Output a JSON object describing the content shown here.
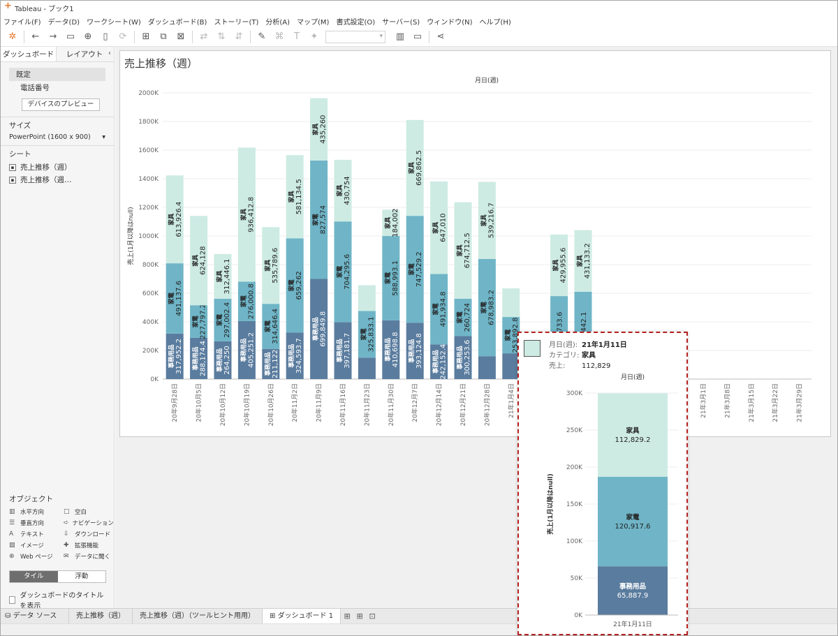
{
  "window": {
    "title": "Tableau - ブック1"
  },
  "menu": [
    "ファイル(F)",
    "データ(D)",
    "ワークシート(W)",
    "ダッシュボード(B)",
    "ストーリー(T)",
    "分析(A)",
    "マップ(M)",
    "書式設定(O)",
    "サーバー(S)",
    "ウィンドウ(N)",
    "ヘルプ(H)"
  ],
  "left_panel": {
    "tab_dashboard": "ダッシュボード",
    "tab_layout": "レイアウト",
    "preset_label": "既定",
    "phone_label": "電話番号",
    "device_preview_button": "デバイスのプレビュー",
    "size_heading": "サイズ",
    "size_value": "PowerPoint (1600 x 900)",
    "sheets_heading": "シート",
    "sheets": [
      "売上推移（週）",
      "売上推移（週…"
    ],
    "objects_heading": "オブジェクト",
    "objects": [
      {
        "label": "水平方向",
        "icon": "horizontal-icon"
      },
      {
        "label": "空白",
        "icon": "blank-icon"
      },
      {
        "label": "垂直方向",
        "icon": "vertical-icon"
      },
      {
        "label": "ナビゲーション",
        "icon": "navigation-icon"
      },
      {
        "label": "テキスト",
        "icon": "text-icon"
      },
      {
        "label": "ダウンロード",
        "icon": "download-icon"
      },
      {
        "label": "イメージ",
        "icon": "image-icon"
      },
      {
        "label": "拡張機能",
        "icon": "extension-icon"
      },
      {
        "label": "Web ページ",
        "icon": "web-icon"
      },
      {
        "label": "データに聞く",
        "icon": "ask-data-icon"
      }
    ],
    "tile_button": "タイル",
    "float_button": "浮動",
    "show_title_label": "ダッシュボードのタイトルを表示"
  },
  "bottom_tabs": {
    "data_source": "データ ソース",
    "tabs": [
      "売上推移（週）",
      "売上推移（週）（ツールヒント用用）",
      "ダッシュボード 1"
    ],
    "active_index": 2
  },
  "dashboard": {
    "title": "売上推移（週）"
  },
  "colors": {
    "furniture": "#cdebe3",
    "appliance": "#6fb5c7",
    "office": "#5a7c9e",
    "tooltip_border": "#b42121",
    "accent_orange": "#e8762b"
  },
  "chart_data": [
    {
      "type": "bar",
      "stacked": true,
      "column_header": "月日(週)",
      "ylabel": "売上(1月以降はnull)",
      "ylim": [
        0,
        2000000
      ],
      "yticks": [
        "0K",
        "200K",
        "400K",
        "600K",
        "800K",
        "1000K",
        "1200K",
        "1400K",
        "1600K",
        "1800K",
        "2000K"
      ],
      "categories": [
        "20年9月28日",
        "20年10月5日",
        "20年10月12日",
        "20年10月19日",
        "20年10月26日",
        "20年11月2日",
        "20年11月9日",
        "20年11月16日",
        "20年11月23日",
        "20年11月30日",
        "20年12月7日",
        "20年12月14日",
        "20年12月21日",
        "20年12月28日",
        "21年1月4日",
        "21年1月11日",
        "21年1月18日",
        "21年1月25日",
        "21年2月1日",
        "21年2月8日",
        "21年2月15日",
        "21年2月22日",
        "21年3月1日",
        "21年3月8日",
        "21年3月15日",
        "21年3月22日",
        "21年3月29日"
      ],
      "series": [
        {
          "name": "事務用品",
          "values": [
            317952.2,
            288174.4,
            264250,
            405251.2,
            211122,
            324593.7,
            699849.8,
            397181.7,
            150000,
            410698.8,
            393124.8,
            242152.4,
            300253.6,
            160000,
            180000,
            65887.9,
            160000,
            150000,
            null,
            null,
            null,
            null,
            null,
            null,
            null,
            null,
            null
          ],
          "labels": [
            "317,952.2",
            "288,174.4",
            "264,250",
            "405,251.2",
            "211,122",
            "324,593.7",
            "699,849.8",
            "397,181.7",
            "",
            "410,698.8",
            "393,124.8",
            "242,152.4",
            "300,253.6",
            "",
            "",
            "",
            "",
            "",
            "",
            "",
            "",
            "",
            "",
            "",
            "",
            "",
            ""
          ]
        },
        {
          "name": "家電",
          "values": [
            491137.6,
            227797.2,
            297002.4,
            276000.8,
            314646.4,
            659262,
            827574,
            704295.6,
            325833.1,
            588993.1,
            747529.2,
            491934.8,
            260724,
            678983.2,
            253892.8,
            120917.6,
            420000,
            460000,
            null,
            null,
            null,
            null,
            null,
            null,
            null,
            null,
            null
          ],
          "labels": [
            "491,137.6",
            "227,797.2",
            "297,002.4",
            "276,000.8",
            "314,646.4",
            "659,262",
            "827,574",
            "704,295.6",
            "325,833.1",
            "588,993.1",
            "747,529.2",
            "491,934.8",
            "260,724",
            "678,983.2",
            "253,892.8",
            "",
            "",
            "",
            "",
            "",
            "",
            "",
            "",
            "",
            "",
            "",
            ""
          ]
        },
        {
          "name": "家具",
          "values": [
            613926.4,
            624128,
            312446.1,
            936412.8,
            535789.6,
            581134.5,
            435260,
            430754,
            180000,
            184002,
            669862.5,
            647010,
            674712.5,
            539216.7,
            200000,
            112829.2,
            429955.6,
            431133.2,
            null,
            null,
            null,
            null,
            null,
            null,
            null,
            null,
            null
          ],
          "labels": [
            "613,926.4",
            "624,128",
            "312,446.1",
            "936,412.8",
            "535,789.6",
            "581,134.5",
            "435,260",
            "430,754",
            "",
            "184,002",
            "669,862.5",
            "647,010",
            "674,712.5",
            "539,216.7",
            "",
            "",
            "429,955.6",
            "431,133.2",
            "",
            "",
            "",
            "",
            "",
            "",
            "",
            "",
            ""
          ]
        }
      ],
      "partial_labels": [
        "733.6",
        "442.1"
      ]
    },
    {
      "type": "bar",
      "stacked": true,
      "column_header": "月日(週)",
      "ylabel": "売上(1月以降はnull)",
      "ylim": [
        0,
        300000
      ],
      "yticks": [
        "0K",
        "50K",
        "100K",
        "150K",
        "200K",
        "250K",
        "300K"
      ],
      "categories": [
        "21年1月11日"
      ],
      "series": [
        {
          "name": "事務用品",
          "values": [
            65887.9
          ],
          "labels": [
            "65,887.9"
          ]
        },
        {
          "name": "家電",
          "values": [
            120917.6
          ],
          "labels": [
            "120,917.6"
          ]
        },
        {
          "name": "家具",
          "values": [
            112829.2
          ],
          "labels": [
            "112,829.2"
          ]
        }
      ]
    }
  ],
  "tooltip": {
    "rows": [
      {
        "key": "月日(週):",
        "value": "21年1月11日"
      },
      {
        "key": "カテゴリ:",
        "value": "家具"
      },
      {
        "key": "売上:",
        "value": "112,829"
      }
    ]
  }
}
